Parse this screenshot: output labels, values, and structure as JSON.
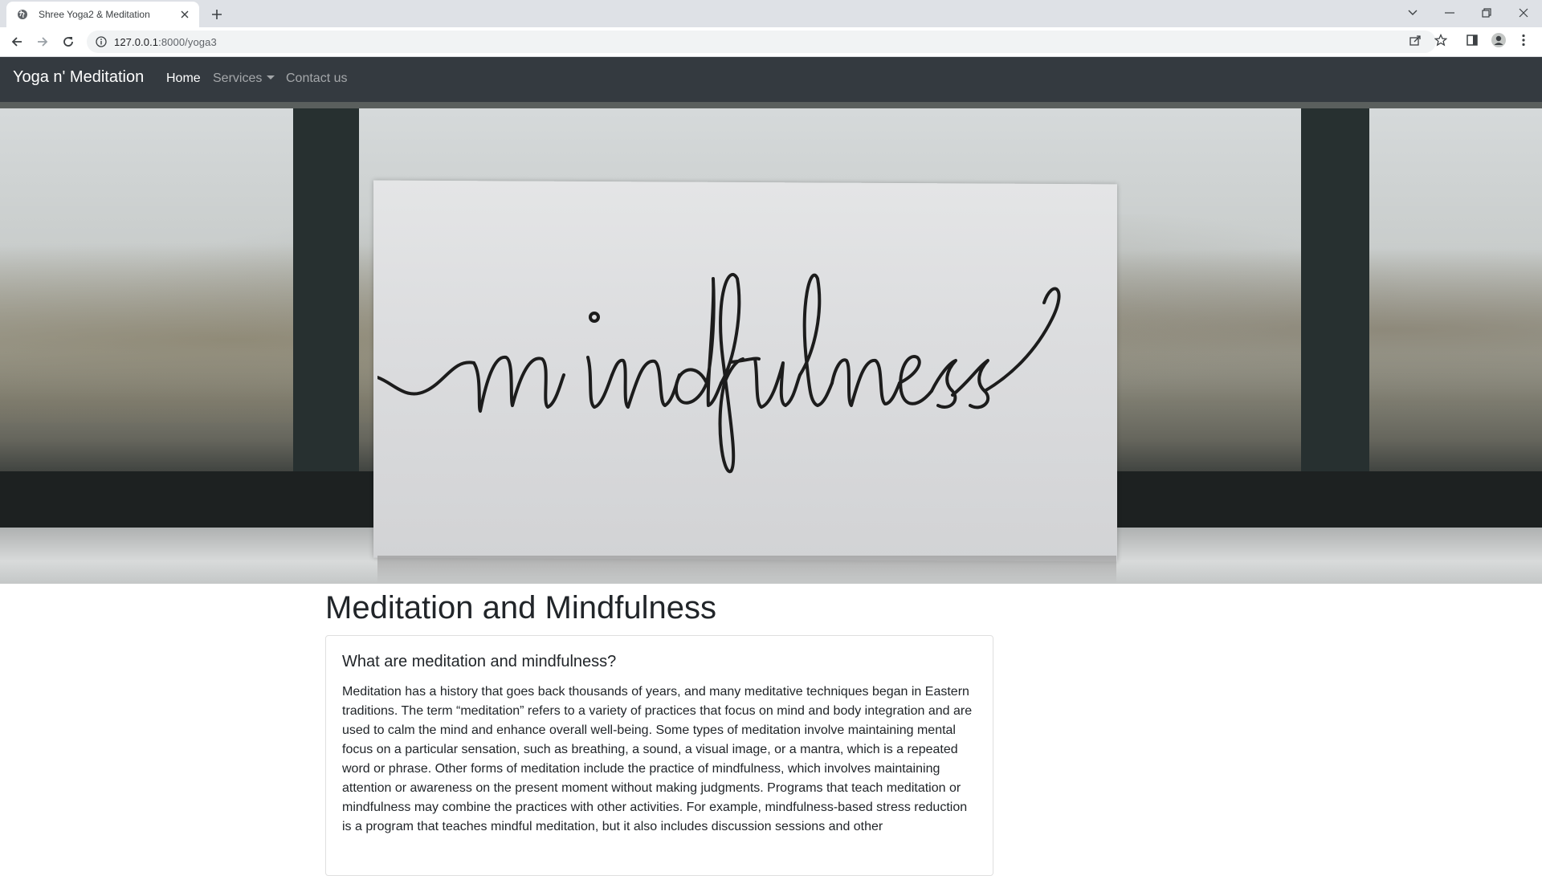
{
  "browser": {
    "tab_title": "Shree Yoga2 & Meditation",
    "url_host": "127.0.0.1",
    "url_path": ":8000/yoga3"
  },
  "navbar": {
    "brand": "Yoga n' Meditation",
    "links": [
      {
        "label": "Home",
        "active": true
      },
      {
        "label": "Services",
        "dropdown": true
      },
      {
        "label": "Contact us"
      }
    ],
    "bg_color": "#343a40"
  },
  "hero": {
    "alt": "mindfulness"
  },
  "main": {
    "title": "Meditation and Mindfulness",
    "card": {
      "heading": "What are meditation and mindfulness?",
      "text": "Meditation has a history that goes back thousands of years, and many meditative techniques began in Eastern traditions. The term “meditation” refers to a variety of practices that focus on mind and body integration and are used to calm the mind and enhance overall well-being. Some types of meditation involve maintaining mental focus on a particular sensation, such as breathing, a sound, a visual image, or a mantra, which is a repeated word or phrase. Other forms of meditation include the practice of mindfulness, which involves maintaining attention or awareness on the present moment without making judgments. Programs that teach meditation or mindfulness may combine the practices with other activities. For example, mindfulness-based stress reduction is a program that teaches mindful meditation, but it also includes discussion sessions and other"
    }
  }
}
